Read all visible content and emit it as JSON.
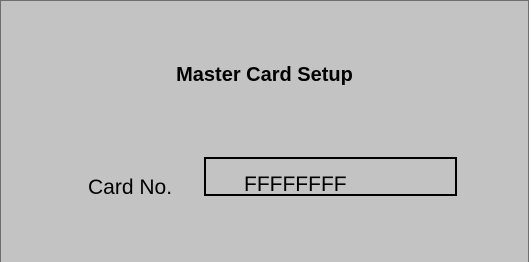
{
  "setup": {
    "title": "Master Card Setup",
    "card_label": "Card No.",
    "card_value": "FFFFFFFF"
  },
  "colors": {
    "panel_background": "#c3c3c3",
    "panel_border": "#6e6e6e",
    "text": "#000000"
  }
}
